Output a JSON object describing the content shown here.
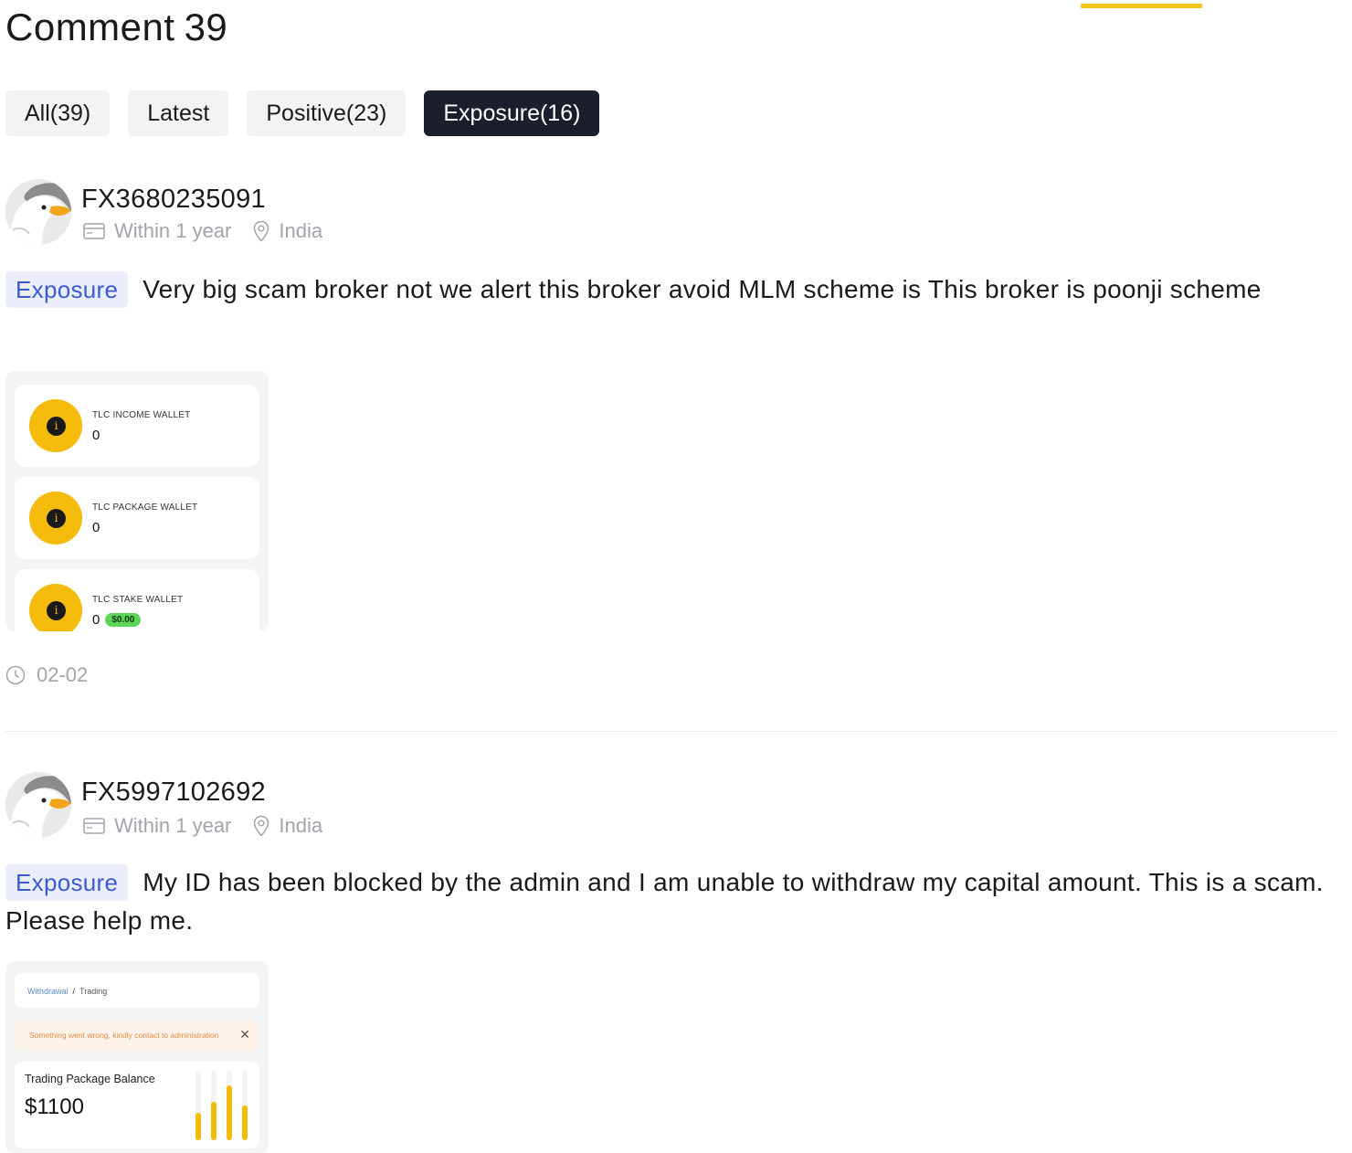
{
  "header": {
    "title_word": "Comment",
    "title_count": "39"
  },
  "tabs": [
    {
      "label": "All(39)",
      "active": false
    },
    {
      "label": "Latest",
      "active": false
    },
    {
      "label": "Positive(23)",
      "active": false
    },
    {
      "label": "Exposure(16)",
      "active": true
    }
  ],
  "comments": [
    {
      "username": "FX3680235091",
      "duration": "Within 1 year",
      "location": "India",
      "tag": "Exposure",
      "text": "Very big scam broker not we alert this broker avoid MLM scheme is This broker is poonji scheme",
      "date": "02-02",
      "screenshot": {
        "wallets": [
          {
            "name": "TLC INCOME WALLET",
            "value": "0"
          },
          {
            "name": "TLC PACKAGE WALLET",
            "value": "0"
          },
          {
            "name": "TLC STAKE WALLET",
            "value": "0",
            "badge": "$0.00"
          }
        ],
        "coin_glyph": "i"
      }
    },
    {
      "username": "FX5997102692",
      "duration": "Within 1 year",
      "location": "India",
      "tag": "Exposure",
      "text": "My ID has been blocked by the admin and I am unable to withdraw my capital amount. This is a scam. Please help me.",
      "screenshot": {
        "breadcrumb_link": "Withdrawal",
        "breadcrumb_sep": "/",
        "breadcrumb_current": "Trading",
        "error_text": "Something went wrong, kindly contact to administration",
        "balance_label": "Trading Package Balance",
        "balance_value": "$1100"
      }
    }
  ],
  "colors": {
    "accent_yellow": "#f5c518",
    "active_tab_bg": "#1a1f2b",
    "tag_bg": "#ebedfb",
    "tag_text": "#3b5ad6",
    "meta_gray": "#a0a4ab"
  }
}
